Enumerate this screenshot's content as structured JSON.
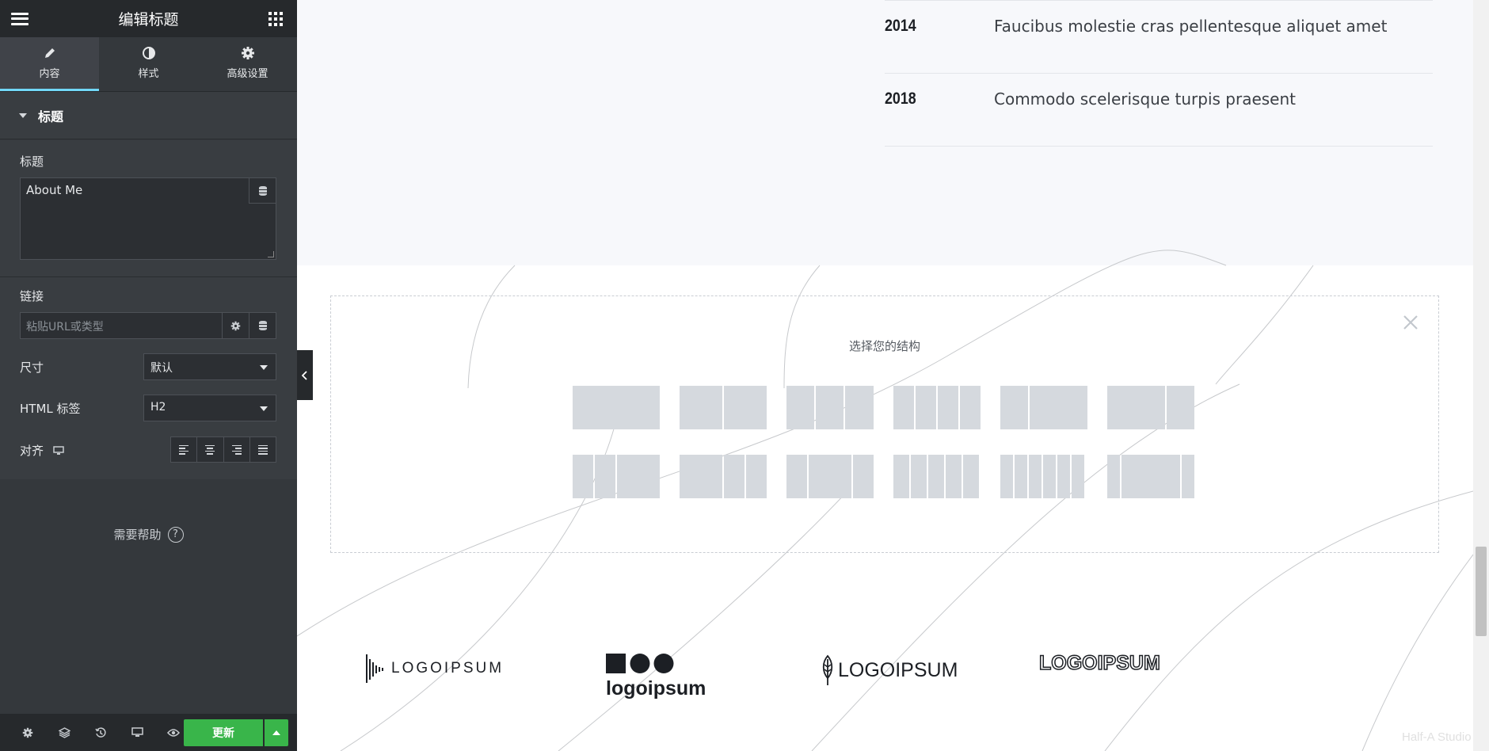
{
  "editor": {
    "title": "编辑标题",
    "tabs": [
      {
        "label": "内容",
        "icon": "pencil-icon",
        "active": true
      },
      {
        "label": "样式",
        "icon": "contrast-icon",
        "active": false
      },
      {
        "label": "高级设置",
        "icon": "gear-icon",
        "active": false
      }
    ],
    "section_title": "标题",
    "title_label": "标题",
    "title_value": "About Me",
    "link_label": "链接",
    "link_placeholder": "粘贴URL或类型",
    "size_label": "尺寸",
    "size_value": "默认",
    "html_tag_label": "HTML 标签",
    "html_tag_value": "H2",
    "align_label": "对齐",
    "help_text": "需要帮助",
    "update_label": "更新",
    "accent_color": "#71d7f7",
    "update_color": "#39b54a"
  },
  "timeline": [
    {
      "year": "2014",
      "text": "Faucibus molestie cras pellentesque aliquet amet"
    },
    {
      "year": "2018",
      "text": "Commodo scelerisque turpis praesent"
    }
  ],
  "structure_picker": {
    "title": "选择您的结构"
  },
  "logos": [
    "LOGOIPSUM",
    "logoipsum",
    "LOGOIPSUM",
    "LOGOIPSUM"
  ],
  "watermark": "Half-A Studio"
}
